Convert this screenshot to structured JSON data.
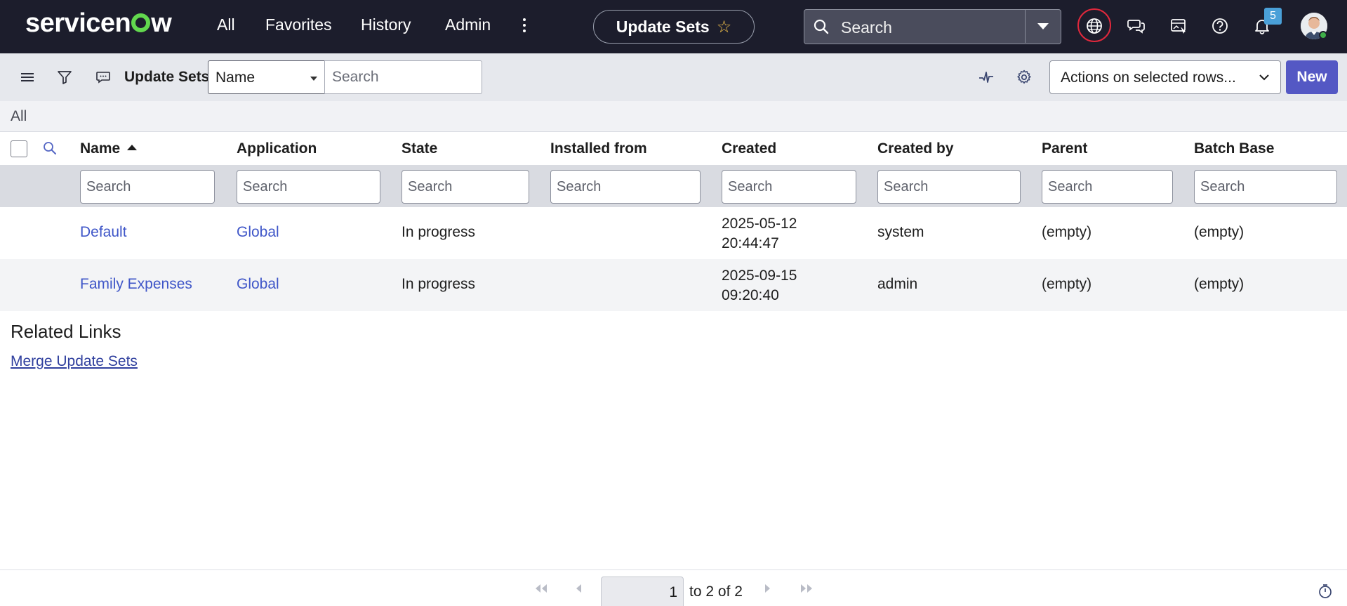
{
  "colors": {
    "nav_bg": "#1c1d2c",
    "accent": "#5458c4",
    "link": "#3f56c8",
    "logo_green": "#62d84e",
    "highlight_ring": "#e0283c",
    "badge": "#4aa0d8"
  },
  "topnav": {
    "logo_text_a": "servicen",
    "logo_text_b": "w",
    "menu": [
      "All",
      "Favorites",
      "History",
      "Admin"
    ],
    "more_icon": "vertical-ellipsis-icon",
    "context_title": "Update Sets",
    "context_star_icon": "star-outline-icon",
    "search_placeholder": "Search",
    "icons": [
      "globe-icon",
      "chat-icon",
      "image-edit-icon",
      "help-icon",
      "bell-icon"
    ],
    "notification_count": "5"
  },
  "toolbar": {
    "menu_icon": "hamburger-icon",
    "filter_icon": "filter-icon",
    "comment_icon": "comment-icon",
    "title": "Update Sets",
    "field_select": "Name",
    "search_placeholder": "Search",
    "activity_icon": "activity-pulse-icon",
    "settings_icon": "gear-icon",
    "actions_label": "Actions on selected rows...",
    "new_label": "New"
  },
  "breadcrumb": "All",
  "table": {
    "columns": [
      "Name",
      "Application",
      "State",
      "Installed from",
      "Created",
      "Created by",
      "Parent",
      "Batch Base"
    ],
    "filter_placeholder": "Search",
    "rows": [
      {
        "name": "Default",
        "application": "Global",
        "state": "In progress",
        "installed_from": "",
        "created_date": "2025-05-12",
        "created_time": "20:44:47",
        "created_by": "system",
        "parent": "(empty)",
        "batch_base": "(empty)"
      },
      {
        "name": "Family Expenses",
        "application": "Global",
        "state": "In progress",
        "installed_from": "",
        "created_date": "2025-09-15",
        "created_time": "09:20:40",
        "created_by": "admin",
        "parent": "(empty)",
        "batch_base": "(empty)"
      }
    ]
  },
  "related": {
    "title": "Related Links",
    "links": [
      "Merge Update Sets"
    ]
  },
  "pagination": {
    "current": "1",
    "to_label": "to",
    "to_value": "2",
    "of_label": "of",
    "total": "2"
  }
}
